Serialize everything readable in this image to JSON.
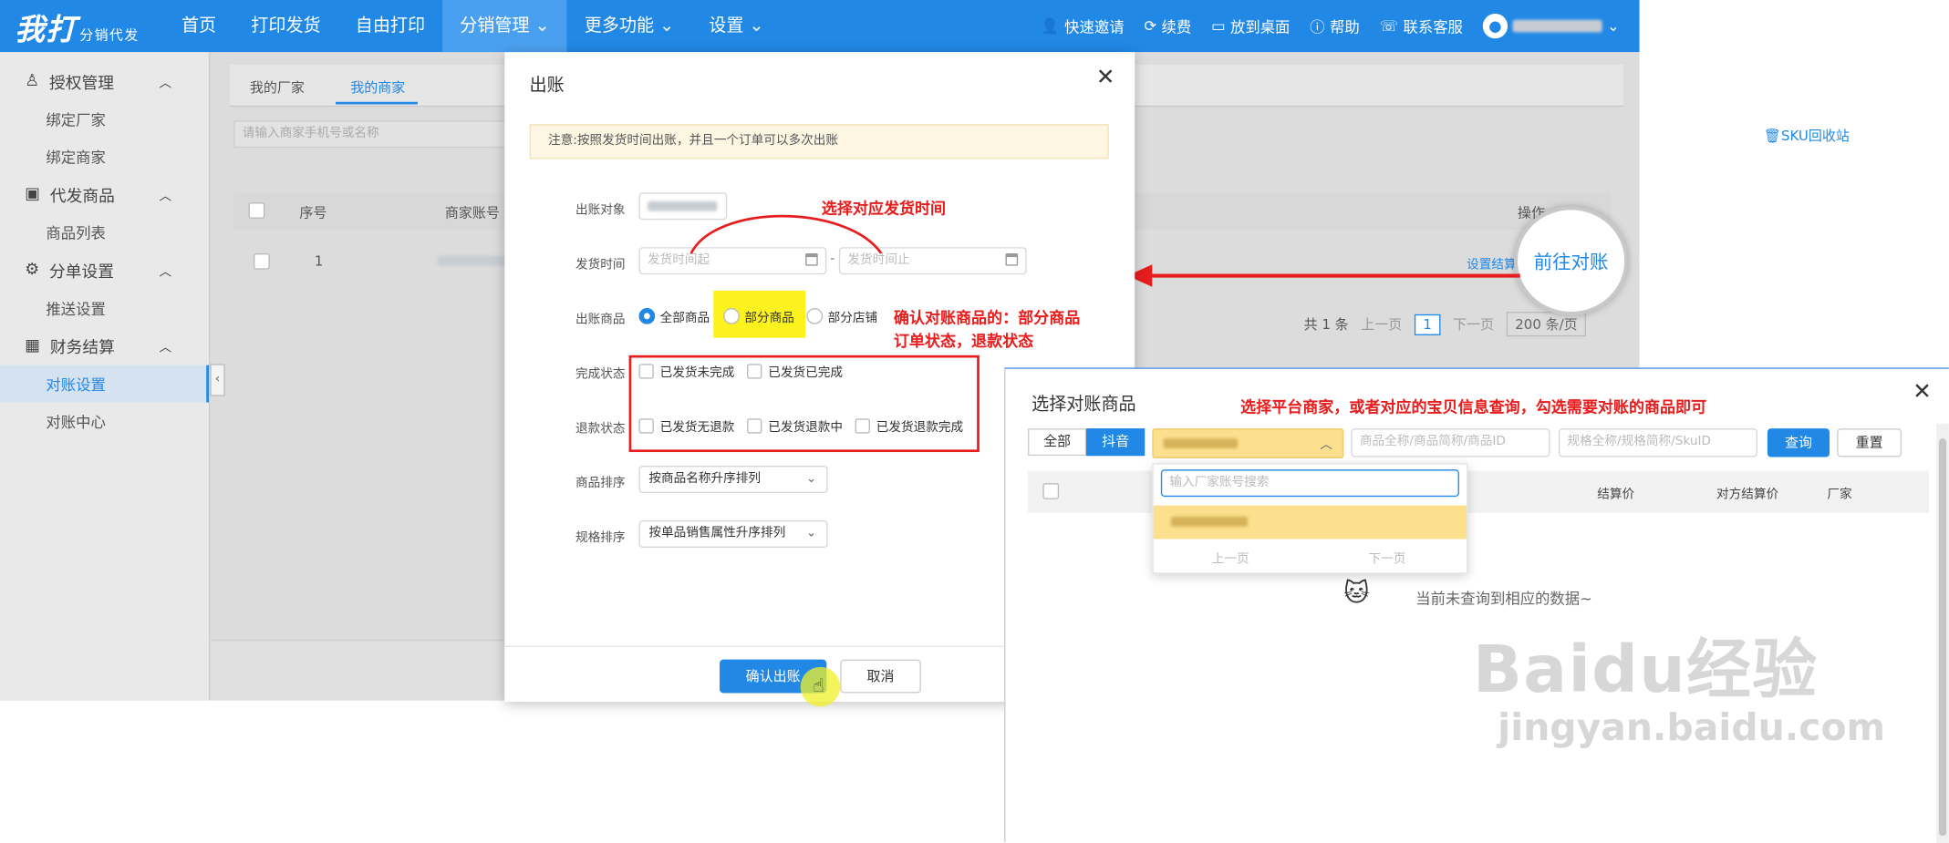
{
  "topbar": {
    "logo": "我打",
    "logo_sub": "分销代发",
    "nav": [
      "首页",
      "打印发货",
      "自由打印",
      "分销管理",
      "更多功能",
      "设置"
    ],
    "actions": [
      "快速邀请",
      "续费",
      "放到桌面",
      "帮助",
      "联系客服"
    ]
  },
  "sidebar": {
    "groups": [
      {
        "label": "授权管理",
        "items": [
          "绑定厂家",
          "绑定商家"
        ]
      },
      {
        "label": "代发商品",
        "items": [
          "商品列表"
        ]
      },
      {
        "label": "分单设置",
        "items": [
          "推送设置"
        ]
      },
      {
        "label": "财务结算",
        "items": [
          "对账设置",
          "对账中心"
        ]
      }
    ]
  },
  "main": {
    "tabs": [
      "我的厂家",
      "我的商家"
    ],
    "search_placeholder": "请输入商家手机号或名称",
    "recycle": "SKU回收站",
    "table_headers": [
      "序号",
      "商家账号",
      "操作"
    ],
    "row_index": "1",
    "row_action": "设置结算",
    "goto_button": "前往对账",
    "pagination": {
      "total": "共 1 条",
      "prev": "上一页",
      "page": "1",
      "next": "下一页",
      "size": "200 条/页"
    }
  },
  "modal": {
    "title": "出账",
    "notice": "注意:按照发货时间出账，并且一个订单可以多次出账",
    "labels": {
      "target": "出账对象",
      "ship_time": "发货时间",
      "goods": "出账商品",
      "complete": "完成状态",
      "refund": "退款状态",
      "goods_sort": "商品排序",
      "spec_sort": "规格排序"
    },
    "ship_start_placeholder": "发货时间起",
    "ship_end_placeholder": "发货时间止",
    "range_sep": "-",
    "goods_options": [
      "全部商品",
      "部分商品",
      "部分店铺"
    ],
    "complete_options": [
      "已发货未完成",
      "已发货已完成"
    ],
    "refund_options": [
      "已发货无退款",
      "已发货退款中",
      "已发货退款完成"
    ],
    "goods_sort_value": "按商品名称升序排列",
    "spec_sort_value": "按单品销售属性升序排列",
    "confirm": "确认出账",
    "cancel": "取消"
  },
  "annotations": {
    "a1": "选择对应发货时间",
    "a2_line1": "确认对账商品的：部分商品",
    "a2_line2": "订单状态，退款状态",
    "a3": "选择平台商家，或者对应的宝贝信息查询，勾选需要对账的商品即可"
  },
  "right_panel": {
    "title": "选择对账商品",
    "segments": [
      "全部",
      "抖音"
    ],
    "goods_placeholder": "商品全称/商品简称/商品ID",
    "sku_placeholder": "规格全称/规格简称/SkuID",
    "query": "查询",
    "reset": "重置",
    "dropdown_placeholder": "输入厂家账号搜索",
    "dropdown_prev": "上一页",
    "dropdown_next": "下一页",
    "headers": [
      "结算价",
      "对方结算价",
      "厂家"
    ],
    "empty": "当前未查询到相应的数据~"
  },
  "watermark": {
    "logo": "Baidu经验",
    "url": "jingyan.baidu.com"
  },
  "colors": {
    "primary": "#2188e6",
    "annotation": "#e81d1d",
    "highlight": "#fbf21e"
  }
}
